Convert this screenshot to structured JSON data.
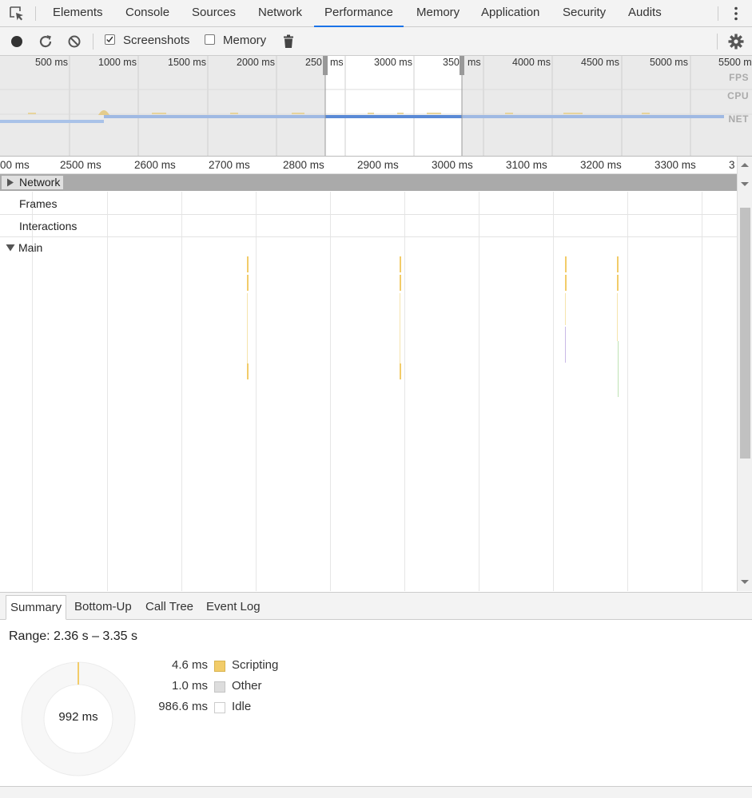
{
  "tabs": [
    {
      "label": "Elements"
    },
    {
      "label": "Console"
    },
    {
      "label": "Sources"
    },
    {
      "label": "Network"
    },
    {
      "label": "Performance",
      "active": true
    },
    {
      "label": "Memory"
    },
    {
      "label": "Application"
    },
    {
      "label": "Security"
    },
    {
      "label": "Audits"
    }
  ],
  "toolbar": {
    "screenshots_label": "Screenshots",
    "screenshots_checked": true,
    "memory_label": "Memory",
    "memory_checked": false
  },
  "overview": {
    "ticks": [
      "500 ms",
      "1000 ms",
      "1500 ms",
      "2000 ms",
      "250",
      "ms",
      "3000 ms",
      "350",
      "ms",
      "4000 ms",
      "4500 ms",
      "5000 ms",
      "5500 m"
    ],
    "lane_labels": {
      "fps": "FPS",
      "cpu": "CPU",
      "net": "NET"
    }
  },
  "ruler": {
    "ticks": [
      "00 ms",
      "2500 ms",
      "2600 ms",
      "2700 ms",
      "2800 ms",
      "2900 ms",
      "3000 ms",
      "3100 ms",
      "3200 ms",
      "3300 ms",
      "3"
    ]
  },
  "tracks": {
    "network": "Network",
    "frames": "Frames",
    "interactions": "Interactions",
    "main": "Main"
  },
  "bottom_tabs": [
    {
      "label": "Summary",
      "active": true
    },
    {
      "label": "Bottom-Up"
    },
    {
      "label": "Call Tree"
    },
    {
      "label": "Event Log"
    }
  ],
  "summary": {
    "range": "Range: 2.36 s – 3.35 s",
    "total": "992 ms",
    "legend": [
      {
        "value": "4.6 ms",
        "name": "Scripting",
        "color": "#f2cc69"
      },
      {
        "value": "1.0 ms",
        "name": "Other",
        "color": "#dddddd"
      },
      {
        "value": "986.6 ms",
        "name": "Idle",
        "color": "#ffffff"
      }
    ]
  },
  "colors": {
    "accent": "#1a73e8",
    "scripting": "#f2cc69",
    "net_bar": "#5a8ad6"
  }
}
